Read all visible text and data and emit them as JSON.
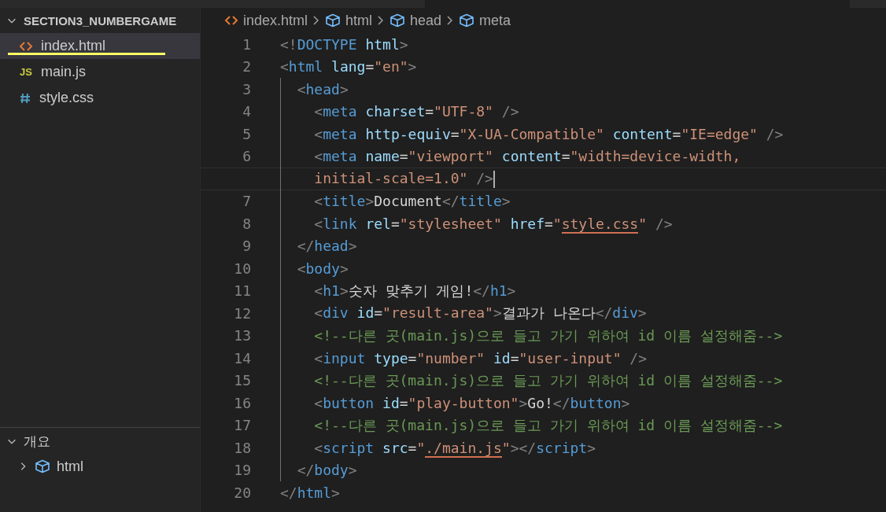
{
  "explorer": {
    "title": "SECTION3_NUMBERGAME",
    "expanded": true,
    "files": [
      {
        "name": "index.html",
        "kind": "html",
        "selected": true,
        "marked": true
      },
      {
        "name": "main.js",
        "kind": "js",
        "badge": "JS",
        "selected": false,
        "marked": false
      },
      {
        "name": "style.css",
        "kind": "css",
        "selected": false,
        "marked": false
      }
    ]
  },
  "outline": {
    "title": "개요",
    "expanded": true,
    "items": [
      {
        "name": "html",
        "expanded": false
      }
    ]
  },
  "breadcrumb": [
    {
      "label": "index.html",
      "kind": "html"
    },
    {
      "label": "html",
      "kind": "symbol"
    },
    {
      "label": "head",
      "kind": "symbol"
    },
    {
      "label": "meta",
      "kind": "symbol"
    }
  ],
  "editor": {
    "lines": [
      {
        "number": "1",
        "rows": [
          {
            "current": false,
            "tokens": [
              {
                "kind": "punct",
                "text": "<!"
              },
              {
                "kind": "tag",
                "text": "DOCTYPE"
              },
              {
                "kind": "attr",
                "text": " html"
              },
              {
                "kind": "punct",
                "text": ">"
              }
            ]
          }
        ]
      },
      {
        "number": "2",
        "rows": [
          {
            "current": false,
            "tokens": [
              {
                "kind": "punct",
                "text": "<"
              },
              {
                "kind": "tag",
                "text": "html"
              },
              {
                "kind": "attr",
                "text": " lang"
              },
              {
                "kind": "text",
                "text": "="
              },
              {
                "kind": "string",
                "text": "\"en\""
              },
              {
                "kind": "punct",
                "text": ">"
              }
            ]
          }
        ]
      },
      {
        "number": "3",
        "rows": [
          {
            "current": false,
            "tokens": [
              {
                "kind": "punct",
                "text": "  <"
              },
              {
                "kind": "tag",
                "text": "head"
              },
              {
                "kind": "punct",
                "text": ">"
              }
            ]
          }
        ]
      },
      {
        "number": "4",
        "rows": [
          {
            "current": false,
            "tokens": [
              {
                "kind": "punct",
                "text": "    <"
              },
              {
                "kind": "tag",
                "text": "meta"
              },
              {
                "kind": "attr",
                "text": " charset"
              },
              {
                "kind": "text",
                "text": "="
              },
              {
                "kind": "string",
                "text": "\"UTF-8\""
              },
              {
                "kind": "punct",
                "text": " />"
              }
            ]
          }
        ]
      },
      {
        "number": "5",
        "rows": [
          {
            "current": false,
            "tokens": [
              {
                "kind": "punct",
                "text": "    <"
              },
              {
                "kind": "tag",
                "text": "meta"
              },
              {
                "kind": "attr",
                "text": " http-equiv"
              },
              {
                "kind": "text",
                "text": "="
              },
              {
                "kind": "string",
                "text": "\"X-UA-Compatible\""
              },
              {
                "kind": "attr",
                "text": " content"
              },
              {
                "kind": "text",
                "text": "="
              },
              {
                "kind": "string",
                "text": "\"IE=edge\""
              },
              {
                "kind": "punct",
                "text": " />"
              }
            ]
          }
        ]
      },
      {
        "number": "6",
        "rows": [
          {
            "current": false,
            "tokens": [
              {
                "kind": "punct",
                "text": "    <"
              },
              {
                "kind": "tag",
                "text": "meta"
              },
              {
                "kind": "attr",
                "text": " name"
              },
              {
                "kind": "text",
                "text": "="
              },
              {
                "kind": "string",
                "text": "\"viewport\""
              },
              {
                "kind": "attr",
                "text": " content"
              },
              {
                "kind": "text",
                "text": "="
              },
              {
                "kind": "string",
                "text": "\"width=device-width,"
              }
            ]
          },
          {
            "current": true,
            "tokens": [
              {
                "kind": "string",
                "text": "    initial-scale=1.0\""
              },
              {
                "kind": "punct",
                "text": " />"
              }
            ]
          }
        ]
      },
      {
        "number": "7",
        "rows": [
          {
            "current": false,
            "tokens": [
              {
                "kind": "punct",
                "text": "    <"
              },
              {
                "kind": "tag",
                "text": "title"
              },
              {
                "kind": "punct",
                "text": ">"
              },
              {
                "kind": "text",
                "text": "Document"
              },
              {
                "kind": "punct",
                "text": "</"
              },
              {
                "kind": "tag",
                "text": "title"
              },
              {
                "kind": "punct",
                "text": ">"
              }
            ]
          }
        ]
      },
      {
        "number": "8",
        "rows": [
          {
            "current": false,
            "tokens": [
              {
                "kind": "punct",
                "text": "    <"
              },
              {
                "kind": "tag",
                "text": "link"
              },
              {
                "kind": "attr",
                "text": " rel"
              },
              {
                "kind": "text",
                "text": "="
              },
              {
                "kind": "string",
                "text": "\"stylesheet\""
              },
              {
                "kind": "attr",
                "text": " href"
              },
              {
                "kind": "text",
                "text": "="
              },
              {
                "kind": "string",
                "text": "\""
              },
              {
                "kind": "link",
                "text": "style.css"
              },
              {
                "kind": "string",
                "text": "\""
              },
              {
                "kind": "punct",
                "text": " />"
              }
            ]
          }
        ]
      },
      {
        "number": "9",
        "rows": [
          {
            "current": false,
            "tokens": [
              {
                "kind": "punct",
                "text": "  </"
              },
              {
                "kind": "tag",
                "text": "head"
              },
              {
                "kind": "punct",
                "text": ">"
              }
            ]
          }
        ]
      },
      {
        "number": "10",
        "rows": [
          {
            "current": false,
            "tokens": [
              {
                "kind": "punct",
                "text": "  <"
              },
              {
                "kind": "tag",
                "text": "body"
              },
              {
                "kind": "punct",
                "text": ">"
              }
            ]
          }
        ]
      },
      {
        "number": "11",
        "rows": [
          {
            "current": false,
            "tokens": [
              {
                "kind": "punct",
                "text": "    <"
              },
              {
                "kind": "tag",
                "text": "h1"
              },
              {
                "kind": "punct",
                "text": ">"
              },
              {
                "kind": "text",
                "text": "숫자 맞추기 게임!"
              },
              {
                "kind": "punct",
                "text": "</"
              },
              {
                "kind": "tag",
                "text": "h1"
              },
              {
                "kind": "punct",
                "text": ">"
              }
            ]
          }
        ]
      },
      {
        "number": "12",
        "rows": [
          {
            "current": false,
            "tokens": [
              {
                "kind": "punct",
                "text": "    <"
              },
              {
                "kind": "tag",
                "text": "div"
              },
              {
                "kind": "attr",
                "text": " id"
              },
              {
                "kind": "text",
                "text": "="
              },
              {
                "kind": "string",
                "text": "\"result-area\""
              },
              {
                "kind": "punct",
                "text": ">"
              },
              {
                "kind": "text",
                "text": "결과가 나온다"
              },
              {
                "kind": "punct",
                "text": "</"
              },
              {
                "kind": "tag",
                "text": "div"
              },
              {
                "kind": "punct",
                "text": ">"
              }
            ]
          }
        ]
      },
      {
        "number": "13",
        "rows": [
          {
            "current": false,
            "tokens": [
              {
                "kind": "comment",
                "text": "    <!--다른 곳(main.js)으로 들고 가기 위하여 id 이름 설정해줌-->"
              }
            ]
          }
        ]
      },
      {
        "number": "14",
        "rows": [
          {
            "current": false,
            "tokens": [
              {
                "kind": "punct",
                "text": "    <"
              },
              {
                "kind": "tag",
                "text": "input"
              },
              {
                "kind": "attr",
                "text": " type"
              },
              {
                "kind": "text",
                "text": "="
              },
              {
                "kind": "string",
                "text": "\"number\""
              },
              {
                "kind": "attr",
                "text": " id"
              },
              {
                "kind": "text",
                "text": "="
              },
              {
                "kind": "string",
                "text": "\"user-input\""
              },
              {
                "kind": "punct",
                "text": " />"
              }
            ]
          }
        ]
      },
      {
        "number": "15",
        "rows": [
          {
            "current": false,
            "tokens": [
              {
                "kind": "comment",
                "text": "    <!--다른 곳(main.js)으로 들고 가기 위하여 id 이름 설정해줌-->"
              }
            ]
          }
        ]
      },
      {
        "number": "16",
        "rows": [
          {
            "current": false,
            "tokens": [
              {
                "kind": "punct",
                "text": "    <"
              },
              {
                "kind": "tag",
                "text": "button"
              },
              {
                "kind": "attr",
                "text": " id"
              },
              {
                "kind": "text",
                "text": "="
              },
              {
                "kind": "string",
                "text": "\"play-button\""
              },
              {
                "kind": "punct",
                "text": ">"
              },
              {
                "kind": "text",
                "text": "Go!"
              },
              {
                "kind": "punct",
                "text": "</"
              },
              {
                "kind": "tag",
                "text": "button"
              },
              {
                "kind": "punct",
                "text": ">"
              }
            ]
          }
        ]
      },
      {
        "number": "17",
        "rows": [
          {
            "current": false,
            "tokens": [
              {
                "kind": "comment",
                "text": "    <!--다른 곳(main.js)으로 들고 가기 위하여 id 이름 설정해줌-->"
              }
            ]
          }
        ]
      },
      {
        "number": "18",
        "rows": [
          {
            "current": false,
            "tokens": [
              {
                "kind": "punct",
                "text": "    <"
              },
              {
                "kind": "tag",
                "text": "script"
              },
              {
                "kind": "attr",
                "text": " src"
              },
              {
                "kind": "text",
                "text": "="
              },
              {
                "kind": "string",
                "text": "\""
              },
              {
                "kind": "link",
                "text": "./main.js"
              },
              {
                "kind": "string",
                "text": "\""
              },
              {
                "kind": "punct",
                "text": "></"
              },
              {
                "kind": "tag",
                "text": "script"
              },
              {
                "kind": "punct",
                "text": ">"
              }
            ]
          }
        ]
      },
      {
        "number": "19",
        "rows": [
          {
            "current": false,
            "tokens": [
              {
                "kind": "punct",
                "text": "  </"
              },
              {
                "kind": "tag",
                "text": "body"
              },
              {
                "kind": "punct",
                "text": ">"
              }
            ]
          }
        ]
      },
      {
        "number": "20",
        "rows": [
          {
            "current": false,
            "tokens": [
              {
                "kind": "punct",
                "text": "</"
              },
              {
                "kind": "tag",
                "text": "html"
              },
              {
                "kind": "punct",
                "text": ">"
              }
            ]
          }
        ]
      }
    ]
  }
}
